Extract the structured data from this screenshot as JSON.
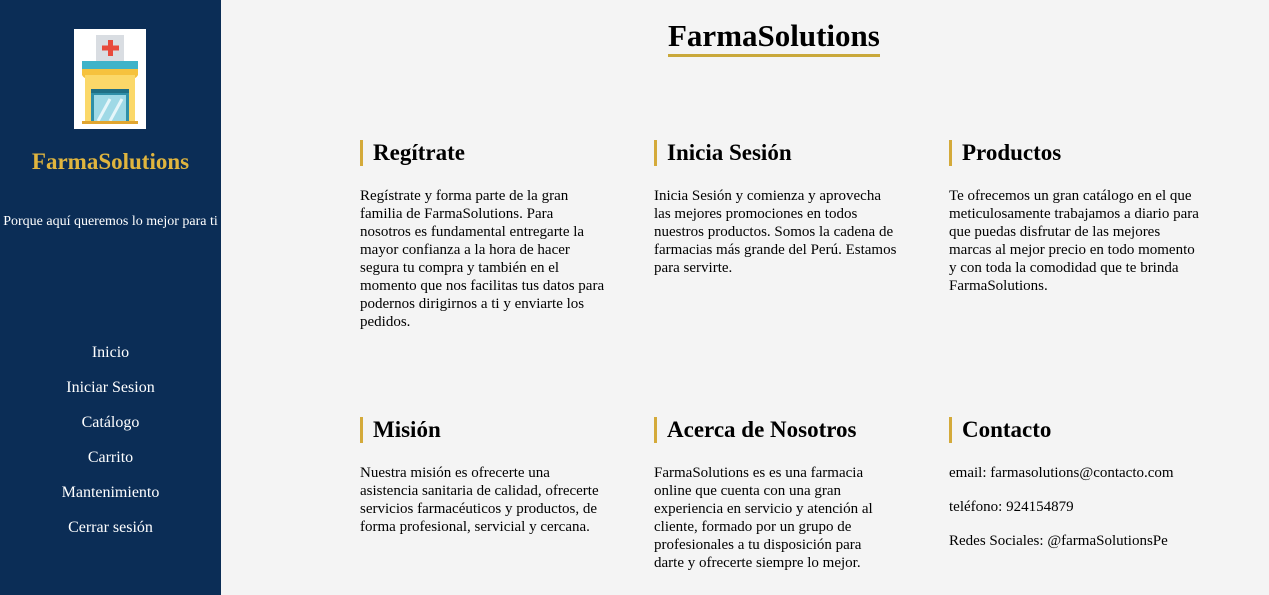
{
  "sidebar": {
    "brand": "FarmaSolutions",
    "tagline": "Porque aquí queremos lo mejor para ti",
    "nav": [
      "Inicio",
      "Iniciar Sesion",
      "Catálogo",
      "Carrito",
      "Mantenimiento",
      "Cerrar sesión"
    ],
    "logo_icon": "pharmacy-store-icon"
  },
  "main": {
    "title": "FarmaSolutions",
    "cards": [
      {
        "title": "Regítrate",
        "text": "Regístrate y forma parte de la gran familia de FarmaSolutions. Para nosotros es fundamental entregarte la mayor confianza a la hora de hacer segura tu compra y también en el momento que nos facilitas tus datos para podernos dirigirnos a ti y enviarte los pedidos."
      },
      {
        "title": "Inicia Sesión",
        "text": "Inicia Sesión y comienza y aprovecha las mejores promociones en todos nuestros productos. Somos la cadena de farmacias más grande del Perú. Estamos para servirte."
      },
      {
        "title": "Productos",
        "text": "Te ofrecemos un gran catálogo en el que meticulosamente trabajamos a diario para que puedas disfrutar de las mejores marcas al mejor precio en todo momento y con toda la comodidad que te brinda FarmaSolutions."
      },
      {
        "title": "Misión",
        "text": "Nuestra misión es ofrecerte una asistencia sanitaria de calidad, ofrecerte servicios farmacéuticos y productos, de forma profesional, servicial y cercana."
      },
      {
        "title": "Acerca de Nosotros",
        "text": "FarmaSolutions es es una farmacia online que cuenta con una gran experiencia en servicio y atención al cliente, formado por un grupo de profesionales a tu disposición para darte y ofrecerte siempre lo mejor."
      }
    ],
    "contact": {
      "title": "Contacto",
      "email": "email: farmasolutions@contacto.com",
      "phone": "teléfono: 924154879",
      "social": "Redes Sociales: @farmaSolutionsPe"
    }
  },
  "colors": {
    "sidebar_bg": "#0b2d56",
    "accent": "#d4aa3a",
    "brand_text": "#e0b53e",
    "page_bg": "#f4f4f4"
  }
}
